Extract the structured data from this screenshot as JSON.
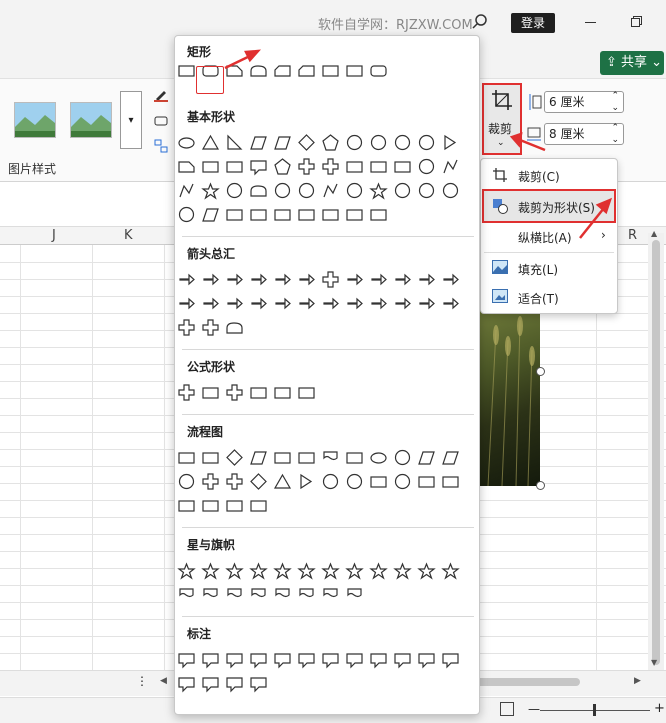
{
  "titlebar": {
    "watermark": "软件自学网：RJZXW.COM",
    "login_label": "登录"
  },
  "ribbon": {
    "share_label": "共享",
    "picture_styles_label": "图片样式",
    "crop_label": "裁剪",
    "height_value": "6 厘米",
    "width_value": "8 厘米"
  },
  "sheet": {
    "columns": [
      "J",
      "K",
      "R"
    ]
  },
  "shapes_panel": {
    "sections": [
      {
        "title": "矩形",
        "count": 9
      },
      {
        "title": "基本形状",
        "count": 45
      },
      {
        "title": "箭头总汇",
        "count": 27
      },
      {
        "title": "公式形状",
        "count": 6
      },
      {
        "title": "流程图",
        "count": 28
      },
      {
        "title": "星与旗帜",
        "count": 20
      },
      {
        "title": "标注",
        "count": 16
      }
    ]
  },
  "crop_menu": {
    "items": [
      {
        "label": "裁剪(C)",
        "icon": "crop-icon",
        "submenu": false
      },
      {
        "label": "裁剪为形状(S)",
        "icon": "shape-icon",
        "submenu": true
      },
      {
        "label": "纵横比(A)",
        "icon": "",
        "submenu": true
      },
      {
        "label": "填充(L)",
        "icon": "fill-picture-icon",
        "submenu": false
      },
      {
        "label": "适合(T)",
        "icon": "fit-picture-icon",
        "submenu": false
      }
    ]
  },
  "colors": {
    "accent_red": "#e03030",
    "share_green": "#1e7145"
  }
}
